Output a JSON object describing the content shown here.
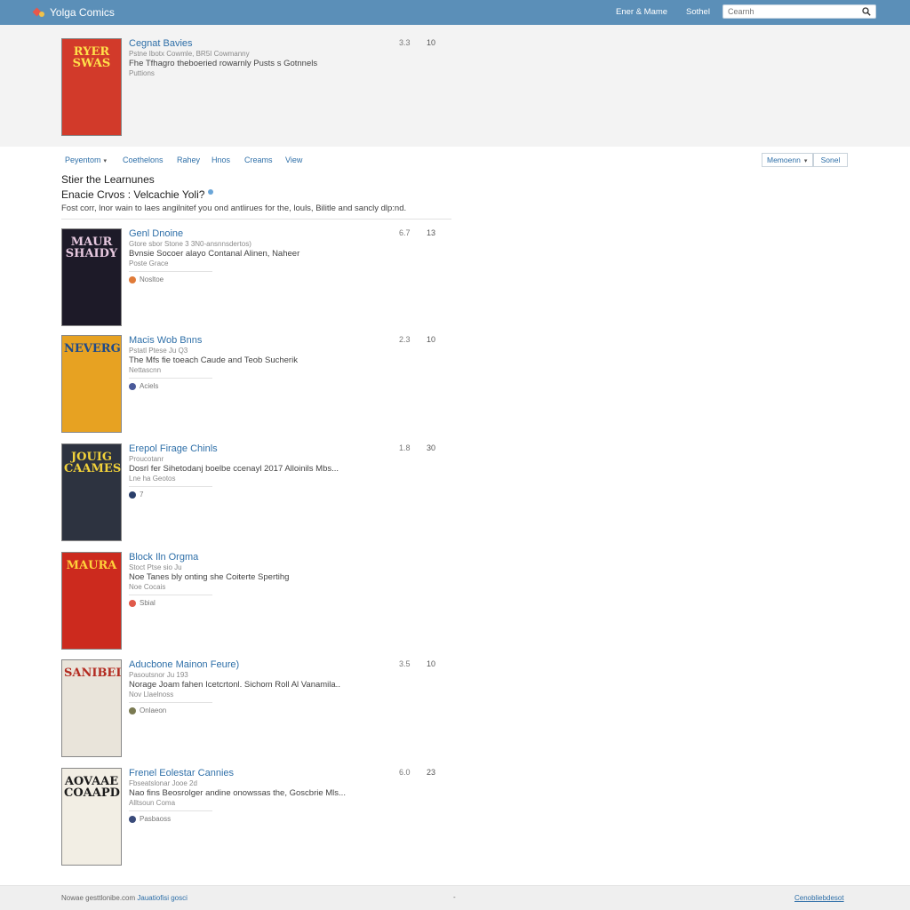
{
  "app": {
    "name": "Yolga Comics"
  },
  "header": {
    "links": [
      "Ener & Mame",
      "Sothel"
    ],
    "search": {
      "placeholder": "Cearnh"
    }
  },
  "featured": {
    "title": "Cegnat Bavies",
    "meta": "Pstne Ibotx Cowmle, BR5I Cowmanny",
    "description": "Fhe Tfhagro theboeried rowarnly Pusts s Gotnnels",
    "sub": "Puttions",
    "rating": "3.3",
    "count": "10",
    "cover": {
      "text": "RYER SWAS",
      "bg": "#d23a2a",
      "fg": "#ffe04a"
    }
  },
  "filters": {
    "items": [
      "Peyentom",
      "Coethelons",
      "Rahey",
      "Hnos",
      "Creams",
      "View"
    ],
    "sort_label": "Memoenn",
    "sort_button": "Sonel"
  },
  "section": {
    "heading": "Stier the Learnunes",
    "question": "Enacie Crvos : Velcachie Yoli?",
    "description": "Fost corr, lnor wain to laes angilnitef you ond antlirues for the, louls, Bilitle and sancly dlp:nd."
  },
  "comics": [
    {
      "title": "Genl Dnoine",
      "meta": "Gtore sbor Stone 3 3N0-ansnnsdertos)",
      "description": "Bvnsie Socoer alayo Contanal Alinen, Naheer",
      "sub": "Poste Grace",
      "tag": "Nosltoe",
      "tag_color": "#e07b39",
      "rating": "6.7",
      "count": "13",
      "cover": {
        "text": "MAUR SHAIDY",
        "bg": "#1d1a28",
        "fg": "#e8c9e0"
      }
    },
    {
      "title": "Macis Wob Bnns",
      "meta": "Pstatl Ptese Ju Q3",
      "description": "The Mfs fie toeach Caude and Teob Sucherik",
      "sub": "Nettascnn",
      "tag": "Aciels",
      "tag_color": "#4a5a9a",
      "rating": "2.3",
      "count": "10",
      "cover": {
        "text": "NEVERGK",
        "bg": "#e7a222",
        "fg": "#1e4a8a"
      }
    },
    {
      "title": "Erepol Firage Chinls",
      "meta": "Proucotanr",
      "description": "Dosrl fer Sihetodanj boelbe ccenayl 2017 Alloinils Mbs...",
      "sub": "Lne ha Geotos",
      "tag": "7",
      "tag_color": "#2a3f6a",
      "rating": "1.8",
      "count": "30",
      "cover": {
        "text": "JOUIG CAAMES",
        "bg": "#2d3340",
        "fg": "#f2d23a"
      }
    },
    {
      "title": "Block Iln Orgma",
      "meta": "Stoct Ptse sio Ju",
      "description": "Noe Tanes bly onting she Coiterte Spertihg",
      "sub": "Noe Cocais",
      "tag": "Sbial",
      "tag_color": "#e05a4a",
      "rating": "",
      "count": "",
      "cover": {
        "text": "MAURA",
        "bg": "#cc2a1e",
        "fg": "#ffd13a"
      }
    },
    {
      "title": "Aducbone Mainon Feure)",
      "meta": "Pasoutsnor Ju 193",
      "description": "Norage Joam fahen Icetcrtonl. Sichom Roll Al Vanamila..",
      "sub": "Nov Llaelnoss",
      "tag": "Onlaeon",
      "tag_color": "#7a7a52",
      "rating": "3.5",
      "count": "10",
      "cover": {
        "text": "SANIBELIAN",
        "bg": "#e9e4da",
        "fg": "#b32a20"
      }
    },
    {
      "title": "Frenel Eolestar Cannies",
      "meta": "Fbseatslonar Jooe 2d",
      "description": "Nao fins Beosrolger andine onowssas the, Goscbrie Mls...",
      "sub": "Alltsoun Coma",
      "tag": "Pasbaoss",
      "tag_color": "#3a4b7a",
      "rating": "6.0",
      "count": "23",
      "cover": {
        "text": "AOVAAE COAAPD",
        "bg": "#f2eee4",
        "fg": "#1a1a1a"
      }
    }
  ],
  "footer": {
    "left_text": "Nowae gesttlonibe.com",
    "left_link": "Jauatiofisi gosci",
    "middle": "-",
    "right": "Cenobliebdesot"
  }
}
